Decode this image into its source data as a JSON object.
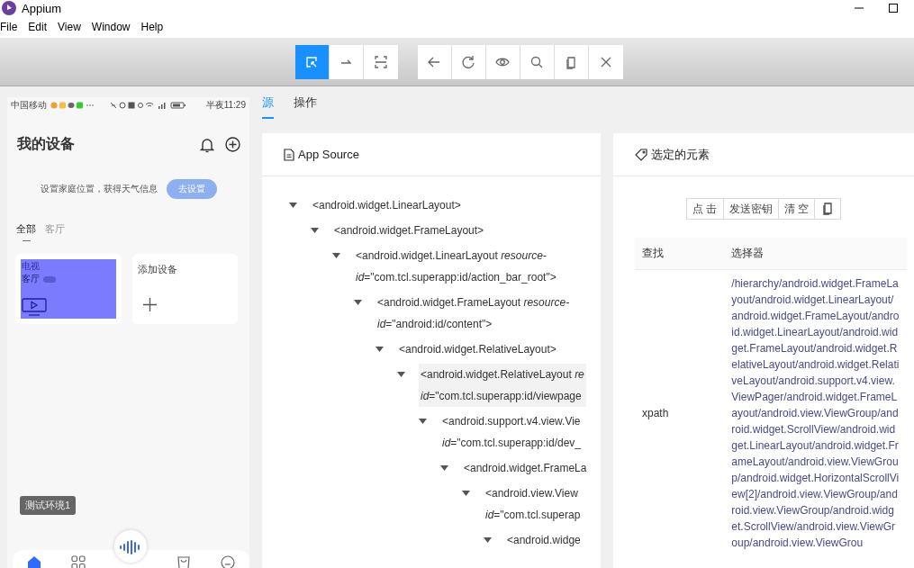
{
  "window": {
    "title": "Appium"
  },
  "menu": [
    "File",
    "Edit",
    "View",
    "Window",
    "Help"
  ],
  "toolbar": {
    "mode_buttons": [
      {
        "kind": "select",
        "selected": true
      },
      {
        "kind": "swipe",
        "selected": false
      },
      {
        "kind": "tap",
        "selected": false
      }
    ],
    "action_buttons": [
      {
        "kind": "back"
      },
      {
        "kind": "refresh"
      },
      {
        "kind": "eye"
      },
      {
        "kind": "search"
      },
      {
        "kind": "copy"
      },
      {
        "kind": "close"
      }
    ]
  },
  "phone": {
    "carrier": "中国移动",
    "time": "半夜11:29",
    "heading": "我的设备",
    "weather_hint": "设置家庭位置，获得天气信息",
    "weather_button": "去设置",
    "room_tabs": [
      {
        "label": "全部",
        "selected": true
      },
      {
        "label": "客厅",
        "selected": false
      }
    ],
    "device_card": {
      "name": "电视",
      "room": "客厅"
    },
    "add_card": {
      "label": "添加设备"
    },
    "toast": "测试环境1",
    "nav": [
      {
        "kind": "home",
        "selected": true
      },
      {
        "kind": "grid",
        "selected": false
      },
      {
        "kind": "voice",
        "selected": false
      },
      {
        "kind": "bag",
        "selected": false
      },
      {
        "kind": "face",
        "selected": false
      }
    ]
  },
  "inspector_tabs": [
    {
      "label": "源",
      "selected": true
    },
    {
      "label": "操作",
      "selected": false
    }
  ],
  "source": {
    "title": "App Source",
    "tree": [
      {
        "lines": [
          "<android.widget.LinearLayout>"
        ],
        "expanded": true,
        "selected": false,
        "children": [
          {
            "lines": [
              "<android.widget.FrameLayout>"
            ],
            "expanded": true,
            "selected": false,
            "children": [
              {
                "lines": [
                  "<android.widget.LinearLayout *resource-*",
                  "*id*=\"com.tcl.superapp:id/action_bar_root\">"
                ],
                "expanded": true,
                "selected": false,
                "children": [
                  {
                    "lines": [
                      "<android.widget.FrameLayout *resource-*",
                      "*id*=\"android:id/content\">"
                    ],
                    "expanded": true,
                    "selected": false,
                    "children": [
                      {
                        "lines": [
                          "<android.widget.RelativeLayout>"
                        ],
                        "expanded": true,
                        "selected": false,
                        "children": [
                          {
                            "lines": [
                              "<android.widget.RelativeLayout *re*",
                              "*id*=\"com.tcl.superapp:id/viewpage"
                            ],
                            "expanded": true,
                            "selected": true,
                            "children": [
                              {
                                "lines": [
                                  "<android.support.v4.view.Vie",
                                  "*id*=\"com.tcl.superapp:id/dev_"
                                ],
                                "expanded": true,
                                "selected": false,
                                "children": [
                                  {
                                    "lines": [
                                      "<android.widget.FrameLa"
                                    ],
                                    "expanded": true,
                                    "selected": false,
                                    "children": [
                                      {
                                        "lines": [
                                          "<android.view.View",
                                          "*id*=\"com.tcl.superap"
                                        ],
                                        "expanded": true,
                                        "selected": false,
                                        "children": [
                                          {
                                            "lines": [
                                              "<android.widge"
                                            ],
                                            "expanded": true,
                                            "selected": false
                                          }
                                        ]
                                      }
                                    ]
                                  }
                                ]
                              }
                            ]
                          }
                        ]
                      }
                    ]
                  }
                ]
              }
            ]
          }
        ]
      }
    ]
  },
  "selected_element": {
    "title": "选定的元素",
    "buttons": [
      "点 击",
      "发送密钥",
      "清 空"
    ],
    "columns": [
      "查找",
      "选择器"
    ],
    "rows": [
      {
        "cells": [
          "xpath",
          "/hierarchy/android.widget.FrameLayout/android.widget.LinearLayout/android.widget.FrameLayout/android.widget.LinearLayout/android.widget.FrameLayout/android.widget.RelativeLayout/android.widget.RelativeLayout/android.support.v4.view.ViewPager/android.widget.FrameLayout/android.view.ViewGroup/android.widget.ScrollView/android.widget.LinearLayout/android.widget.FrameLayout/android.view.ViewGroup/android.widget.HorizontalScrollView[2]/android.view.ViewGroup/android.view.ViewGroup/android.widget.ScrollView/android.view.ViewGroup/android.view.ViewGrou"
        ]
      }
    ]
  }
}
